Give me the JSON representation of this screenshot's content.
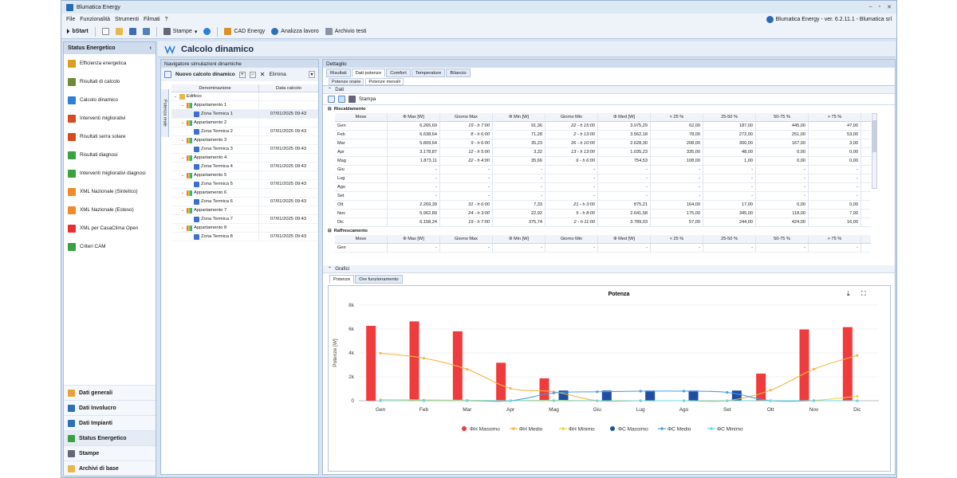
{
  "app": {
    "title": "Blumatica Energy",
    "version": "Blumatica Energy - ver. 6.2.11.1 - Blumatica srl"
  },
  "menu": [
    "File",
    "Funzionalità",
    "Strumenti",
    "Filmati",
    "?"
  ],
  "toolbar": {
    "bstart": "bStart",
    "stampe": "Stampe",
    "cad": "CAD Energy",
    "analizza": "Analizza lavoro",
    "archivio": "Archivio testi"
  },
  "left": {
    "header": "Status Energetico",
    "items": [
      {
        "label": "Efficienza energetica",
        "color": "#d9a020"
      },
      {
        "label": "Risultati di calcolo",
        "color": "#6c8a3a"
      },
      {
        "label": "Calcolo dinamico",
        "color": "#2d7ed8"
      },
      {
        "label": "Interventi migliorativi",
        "color": "#d84a20"
      },
      {
        "label": "Risultati serra solare",
        "color": "#d84a20"
      },
      {
        "label": "Risultati diagnosi",
        "color": "#3aa040"
      },
      {
        "label": "Interventi migliorativi diagnosi",
        "color": "#3aa040"
      },
      {
        "label": "XML Nazionale (Sintetico)",
        "color": "#f08a2a"
      },
      {
        "label": "XML Nazionale (Esteso)",
        "color": "#f08a2a"
      },
      {
        "label": "XML per CasaClima Open",
        "color": "#e83030"
      },
      {
        "label": "Criteri CAM",
        "color": "#3aa040"
      }
    ],
    "bottom": [
      "Dati generali",
      "Dati Involucro",
      "Dati Impianti",
      "Status Energetico",
      "Stampe",
      "Archivi di base"
    ]
  },
  "page": {
    "title": "Calcolo dinamico"
  },
  "nav": {
    "title": "Navigatore simulazioni dinamiche",
    "new_label": "Nuovo calcolo dinamico",
    "delete_label": "Elimina",
    "vtab": "Potenza reale",
    "col1": "Denominazione",
    "col2": "Data calcolo",
    "rows": [
      {
        "label": "Edificio",
        "date": "",
        "indent": 0,
        "kind": "edificio"
      },
      {
        "label": "Appartamento 1",
        "date": "",
        "indent": 1,
        "kind": "app"
      },
      {
        "label": "Zona Termica 1",
        "date": "07/01/2025 09:43",
        "indent": 2,
        "kind": "zona"
      },
      {
        "label": "Appartamento 2",
        "date": "",
        "indent": 1,
        "kind": "app"
      },
      {
        "label": "Zona Termica 2",
        "date": "07/01/2025 09:43",
        "indent": 2,
        "kind": "zona"
      },
      {
        "label": "Appartamento 3",
        "date": "",
        "indent": 1,
        "kind": "app"
      },
      {
        "label": "Zona Termica 3",
        "date": "07/01/2025 09:43",
        "indent": 2,
        "kind": "zona"
      },
      {
        "label": "Appartamento 4",
        "date": "",
        "indent": 1,
        "kind": "app"
      },
      {
        "label": "Zona Termica 4",
        "date": "07/01/2025 09:43",
        "indent": 2,
        "kind": "zona"
      },
      {
        "label": "Appartamento 5",
        "date": "",
        "indent": 1,
        "kind": "app"
      },
      {
        "label": "Zona Termica 5",
        "date": "07/01/2025 09:43",
        "indent": 2,
        "kind": "zona"
      },
      {
        "label": "Appartamento 6",
        "date": "",
        "indent": 1,
        "kind": "app"
      },
      {
        "label": "Zona Termica 6",
        "date": "07/01/2025 09:43",
        "indent": 2,
        "kind": "zona"
      },
      {
        "label": "Appartamento 7",
        "date": "",
        "indent": 1,
        "kind": "app"
      },
      {
        "label": "Zona Termica 7",
        "date": "07/01/2025 09:43",
        "indent": 2,
        "kind": "zona"
      },
      {
        "label": "Appartamento 8",
        "date": "",
        "indent": 1,
        "kind": "app"
      },
      {
        "label": "Zona Termica 8",
        "date": "07/01/2025 09:43",
        "indent": 2,
        "kind": "zona"
      }
    ]
  },
  "detail": {
    "title": "Dettaglio",
    "tabs": [
      "Risultati",
      "Dati potenze",
      "Comfort",
      "Temperature",
      "Bilancio"
    ],
    "subtabs": [
      "Potenze orarie",
      "Potenze mensili"
    ],
    "section_dati": "Dati",
    "stampa": "Stampa",
    "headers": [
      "Mese",
      "Φ Max [W]",
      "Giorno Max",
      "Φ Min [W]",
      "Giorno Min",
      "Φ Med [W]",
      "< 25 %",
      "25-50 %",
      "50-75 %",
      "> 75 %"
    ],
    "riscaldamento_title": "Riscaldamento",
    "riscaldamento": [
      [
        "Gen",
        "6.265,69",
        "19 - h 7:00",
        "91,36",
        "22 - h 15:00",
        "3.975,29",
        "62,00",
        "187,00",
        "445,00",
        "47,00"
      ],
      [
        "Feb",
        "6.638,64",
        "8 - h 6:00",
        "71,28",
        "2 - h 13:00",
        "3.562,18",
        "78,00",
        "272,00",
        "251,00",
        "53,00"
      ],
      [
        "Mar",
        "5.809,64",
        "9 - h 6:00",
        "35,23",
        "26 - h 10:00",
        "2.628,30",
        "208,00",
        "300,00",
        "167,00",
        "3,00"
      ],
      [
        "Apr",
        "3.178,87",
        "12 - h 5:00",
        "3,32",
        "13 - h 13:00",
        "1.035,23",
        "335,00",
        "48,00",
        "0,00",
        "0,00"
      ],
      [
        "Mag",
        "1.873,11",
        "22 - h 4:00",
        "35,66",
        "6 - h 6:00",
        "754,53",
        "108,00",
        "1,00",
        "0,00",
        "0,00"
      ],
      [
        "Giu",
        "-",
        "-",
        "-",
        "-",
        "-",
        "-",
        "-",
        "-",
        "-"
      ],
      [
        "Lug",
        "-",
        "-",
        "-",
        "-",
        "-",
        "-",
        "-",
        "-",
        "-"
      ],
      [
        "Ago",
        "-",
        "-",
        "-",
        "-",
        "-",
        "-",
        "-",
        "-",
        "-"
      ],
      [
        "Set",
        "-",
        "-",
        "-",
        "-",
        "-",
        "-",
        "-",
        "-",
        "-"
      ],
      [
        "Ott",
        "2.269,39",
        "31 - h 6:00",
        "7,33",
        "21 - h 3:00",
        "875,21",
        "164,00",
        "17,00",
        "0,00",
        "0,00"
      ],
      [
        "Nov",
        "5.962,89",
        "24 - h 3:00",
        "22,92",
        "5 - h 8:00",
        "2.641,58",
        "175,00",
        "345,00",
        "118,00",
        "7,00"
      ],
      [
        "Dic",
        "6.158,24",
        "19 - h 7:00",
        "375,74",
        "2 - h 11:00",
        "3.789,03",
        "57,00",
        "244,00",
        "424,00",
        "16,00"
      ]
    ],
    "raffrescamento_title": "Raffrescamento",
    "raffrescamento": [
      [
        "Gen",
        "-",
        "-",
        "-",
        "-",
        "-",
        "-",
        "-",
        "-",
        "-"
      ]
    ],
    "section_grafici": "Grafici",
    "chart_tabs": [
      "Potenze",
      "Ore funzionamento"
    ]
  },
  "chart_data": {
    "type": "bar",
    "title": "Potenza",
    "ylabel": "Potenze [W]",
    "xlabel": "",
    "ylim": [
      0,
      8000
    ],
    "yticks": [
      "0",
      "2k",
      "4k",
      "6k",
      "8k"
    ],
    "categories": [
      "Gen",
      "Feb",
      "Mar",
      "Apr",
      "Mag",
      "Giu",
      "Lug",
      "Ago",
      "Set",
      "Ott",
      "Nov",
      "Dic"
    ],
    "legend_position": "bottom",
    "series": [
      {
        "name": "ΦH Massimo",
        "kind": "bar",
        "color": "#ef3b3b",
        "values": [
          6265.69,
          6638.64,
          5809.64,
          3178.87,
          1873.11,
          0,
          0,
          0,
          0,
          2269.39,
          5962.89,
          6158.24
        ]
      },
      {
        "name": "ΦH Medio",
        "kind": "line",
        "color": "#f5b548",
        "values": [
          3975.29,
          3562.18,
          2628.3,
          1035.23,
          754.53,
          0,
          0,
          0,
          0,
          875.21,
          2641.58,
          3789.03
        ]
      },
      {
        "name": "ΦH Minimo",
        "kind": "line",
        "color": "#f0d23c",
        "values": [
          91.36,
          71.28,
          35.23,
          3.32,
          35.66,
          0,
          0,
          0,
          0,
          7.33,
          22.92,
          375.74
        ]
      },
      {
        "name": "ΦC Massimo",
        "kind": "bar",
        "color": "#1e4fa3",
        "values": [
          0,
          0,
          0,
          0,
          850,
          850,
          850,
          850,
          850,
          0,
          0,
          0
        ]
      },
      {
        "name": "ΦC Medio",
        "kind": "line",
        "color": "#4a9fe0",
        "values": [
          0,
          0,
          0,
          0,
          650,
          750,
          800,
          800,
          700,
          0,
          0,
          0
        ]
      },
      {
        "name": "ΦC Minimo",
        "kind": "line",
        "color": "#6fd3e0",
        "values": [
          0,
          0,
          0,
          0,
          0,
          0,
          0,
          0,
          0,
          0,
          0,
          0
        ]
      }
    ]
  }
}
